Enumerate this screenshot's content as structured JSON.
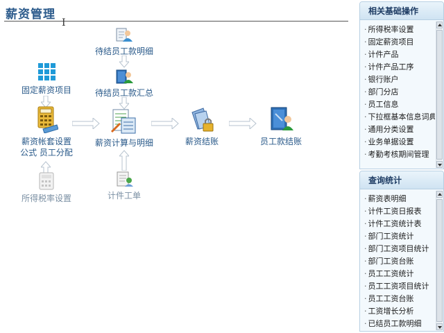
{
  "page": {
    "title": "薪资管理"
  },
  "flow": {
    "pending_detail": "待结员工款明细",
    "pending_summary": "待结员工款汇总",
    "fixed_items": "固定薪资项目",
    "account_setup_line1": "薪资帐套设置",
    "account_setup_line2": "公式 员工分配",
    "tax_rate": "所得税率设置",
    "calc_detail": "薪资计算与明细",
    "piece_work": "计件工单",
    "settlement": "薪资结账",
    "employee_settlement": "员工款结账"
  },
  "sidebar": {
    "basic": {
      "title": "相关基础操作",
      "items": [
        "所得税率设置",
        "固定薪资项目",
        "计件产品",
        "计件产品工序",
        "银行账户",
        "部门分店",
        "员工信息",
        "下拉框基本信息词典",
        "通用分类设置",
        "业务单据设置",
        "考勤考核期间管理"
      ]
    },
    "query": {
      "title": "查询统计",
      "items": [
        "薪资表明细",
        "计件工资日报表",
        "计件工资统计表",
        "部门工资统计",
        "部门工资项目统计",
        "部门工资台账",
        "员工工资统计",
        "员工工资项目统计",
        "员工工资台账",
        "工资增长分析",
        "已结员工款明细"
      ]
    }
  },
  "colors": {
    "title": "#2c5b8c",
    "node_label": "#2a5a8a",
    "muted_label": "#7a8fa3",
    "panel_border": "#b7cfe3"
  }
}
